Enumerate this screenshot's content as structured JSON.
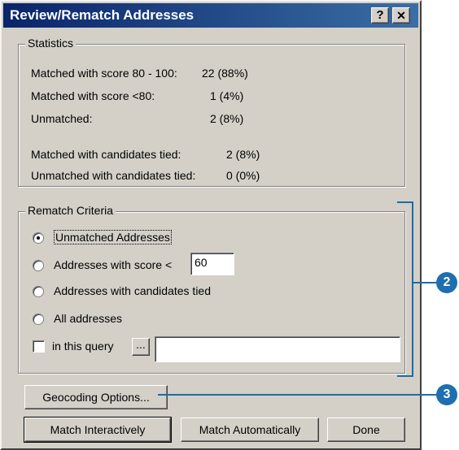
{
  "window": {
    "title": "Review/Rematch Addresses",
    "help_glyph": "?",
    "close_glyph": "✕"
  },
  "statistics": {
    "legend": "Statistics",
    "rows": [
      {
        "label": "Matched with score 80 - 100:",
        "value": "22  (88%)"
      },
      {
        "label": "Matched with score <80:",
        "value": "1  (4%)"
      },
      {
        "label": "Unmatched:",
        "value": "2  (8%)"
      },
      {
        "label": "Matched with candidates tied:",
        "value": "2  (8%)"
      },
      {
        "label": "Unmatched with candidates tied:",
        "value": "0  (0%)"
      }
    ]
  },
  "rematch": {
    "legend": "Rematch Criteria",
    "options": [
      {
        "label": "Unmatched Addresses",
        "selected": true
      },
      {
        "label": "Addresses with score <",
        "selected": false
      },
      {
        "label": "Addresses with candidates tied",
        "selected": false
      },
      {
        "label": "All addresses",
        "selected": false
      }
    ],
    "score_value": "60",
    "query_label": "in this query",
    "query_browse_label": "...",
    "query_value": ""
  },
  "buttons": {
    "geocoding_options": "Geocoding Options...",
    "match_interactively": "Match Interactively",
    "match_automatically": "Match Automatically",
    "done": "Done"
  },
  "callouts": {
    "rematch_number": "2",
    "geocoding_number": "3",
    "color": "#1d6fb0"
  }
}
